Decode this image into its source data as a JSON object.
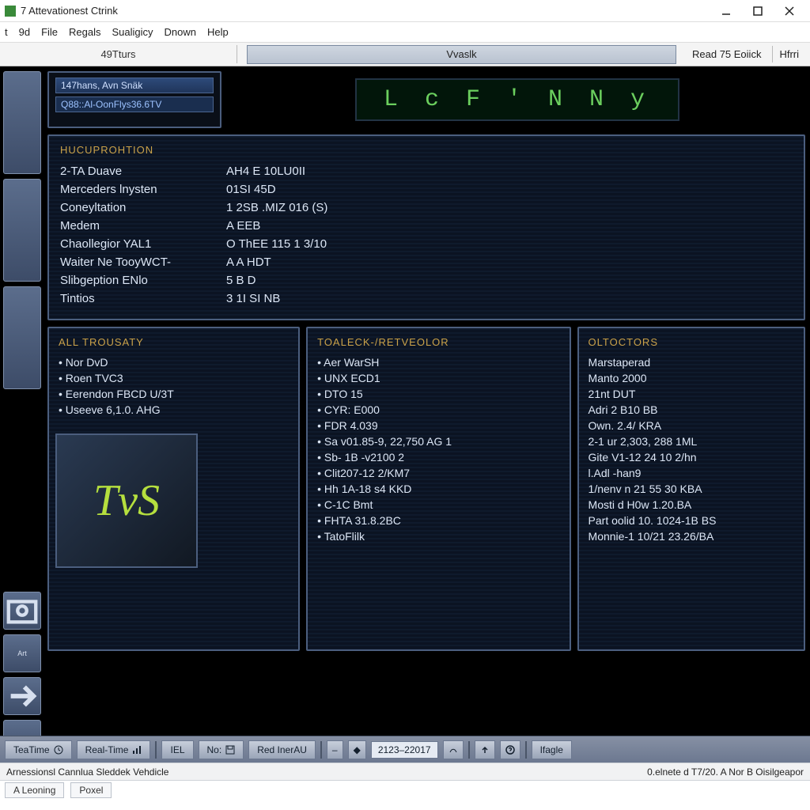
{
  "window": {
    "title": "7 Attevationest Ctrink"
  },
  "menu": {
    "items": [
      "t",
      "9d",
      "File",
      "Regals",
      "Sualigicy",
      "Dnown",
      "Help"
    ]
  },
  "topstrip": {
    "left": "49Tturs",
    "center": "Vvaslk",
    "right": [
      "Read 75 Eoiick",
      "Hfrri"
    ]
  },
  "header": {
    "chip_line1": "147hans, Avn Snäk",
    "chip_line2": "Q88::Al-OonFlys36.6TV",
    "lcd": "L c F ' N  N y"
  },
  "hucuprohtion": {
    "title": "HUCUPROHTION",
    "rows": [
      {
        "k": "2-TA Duave",
        "v": "AH4 E 10LU0II"
      },
      {
        "k": "Merceders lnysten",
        "v": "01SI 45D"
      },
      {
        "k": "Coneyltation",
        "v": "1 2SB .MIZ 016 (S)"
      },
      {
        "k": "Medem",
        "v": "A EEB"
      },
      {
        "k": "Chaollegior YAL1",
        "v": "O ThEE 115 1 3/10"
      },
      {
        "k": "Waiter Ne TooyWCT-",
        "v": "A A HDT"
      },
      {
        "k": "Slibgeption ENlo",
        "v": "5 B D"
      },
      {
        "k": "Tintios",
        "v": "3 1I SI NB"
      }
    ]
  },
  "col_a": {
    "title": "ALL TROUSATY",
    "items": [
      "Nor DvD",
      "Roen TVC3",
      "Eerendon FBCD U/3T",
      "Useeve 6,1.0. AHG"
    ]
  },
  "col_b": {
    "title": "TOALECK-/RETVEOLOR",
    "items": [
      "Aer WarSH",
      "UNX ECD1",
      "DTO 15",
      "CYR: E000",
      "FDR  4.039",
      "Sa v01.85-9, 22,750 AG 1",
      "Sb- 1B -v2100 2",
      "Clit207-12 2/KM7",
      "Hh 1A-18 s4 KKD",
      "C-1C Bmt",
      "FHTA  31.8.2BC",
      "TatoFlilk"
    ]
  },
  "col_c": {
    "title": "OLTOCTORS",
    "items": [
      "Marstaperad",
      "Manto 2000",
      "21nt DUT",
      "Adri 2 B10 BB",
      "Own. 2.4/ KRA",
      "2-1 ur 2,303, 288 1ML",
      "Gite V1-12 24 10 2/hn",
      "l.Adl -han9",
      "1/nenv n 21 55 30 KBA",
      "Mosti d H0w 1.20.BA",
      "Part oolid 10. 1024-1B BS",
      "Monnie-1 10/21 23.26/BA"
    ]
  },
  "logo": "TvS",
  "taskbar": {
    "items": [
      "TeaTime",
      "Real-Time",
      "IEL",
      "No:",
      "Red InerAU"
    ],
    "range": "2123–22017",
    "last": "Ifagle"
  },
  "statusbar": {
    "left": "Arnessionsl Cannlua Sleddek Vehdicle",
    "right": "0.elnete d T7/20. A Nor B Oisilgeapor"
  },
  "statusbar2": {
    "items": [
      "A Leoning",
      "Poxel"
    ]
  }
}
